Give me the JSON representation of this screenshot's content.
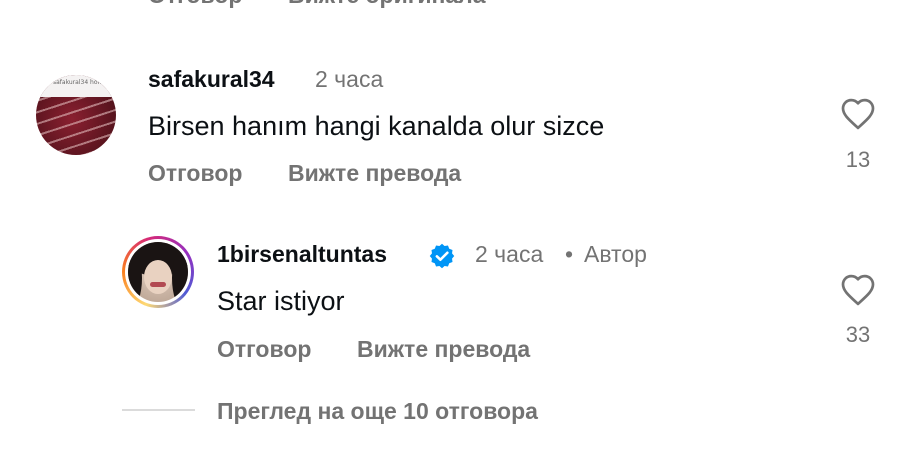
{
  "top_row": {
    "reply_label": "Отговор",
    "translation_label": "Вижте оригинала"
  },
  "comments": [
    {
      "username": "safakural34",
      "time": "2 часа",
      "text": "Birsen hanım hangi kanalda olur sizce",
      "reply_label": "Отговор",
      "translation_label": "Вижте превода",
      "likes": "13",
      "avatar_caption": "safakural34 home"
    },
    {
      "username": "1birsenaltuntas",
      "verified": true,
      "time": "2 часа",
      "separator": "•",
      "author_label": "Автор",
      "text": "Star istiyor",
      "reply_label": "Отговор",
      "translation_label": "Вижте превода",
      "likes": "33"
    }
  ],
  "view_more_replies": "Преглед на още 10 отговора",
  "colors": {
    "text": "#0c1014",
    "secondary": "#737373",
    "verified": "#0095f6",
    "divider": "#dbdbdb"
  }
}
